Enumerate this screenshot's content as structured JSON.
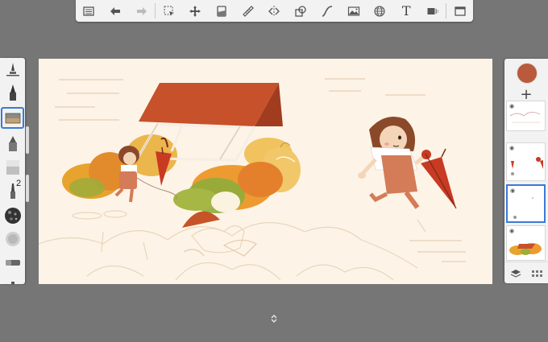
{
  "toolbar": {
    "tools": [
      {
        "name": "gallery-icon"
      },
      {
        "name": "undo-icon"
      },
      {
        "name": "redo-icon"
      },
      {
        "name": "selection-icon"
      },
      {
        "name": "transform-icon"
      },
      {
        "name": "layer-editor-icon"
      },
      {
        "name": "ruler-icon"
      },
      {
        "name": "symmetry-icon"
      },
      {
        "name": "shape-icon"
      },
      {
        "name": "stroke-icon"
      },
      {
        "name": "image-icon"
      },
      {
        "name": "perspective-grid-icon"
      },
      {
        "name": "text-icon"
      },
      {
        "name": "flipbook-icon"
      },
      {
        "name": "fullscreen-icon"
      }
    ],
    "text_glyph": "T"
  },
  "brushes": {
    "selected_index": 2,
    "size_badge": "2",
    "items": [
      "pencil-brush-icon",
      "ink-pen-brush-icon",
      "marker-brush-icon",
      "airbrush-icon",
      "blender-brush-icon",
      "paint-brush-icon",
      "texture-brush-icon",
      "soft-texture-brush-icon",
      "eraser-brush-icon"
    ]
  },
  "layers": {
    "current_color": "#b85a3b",
    "add_glyph": "+",
    "selected_index": 2,
    "eye_glyph": "◉"
  },
  "colors": {
    "canvas": "#fdf4e7",
    "accent": "#3a7bd5",
    "roof": "#c7512a",
    "umbrella": "#c93a22"
  }
}
